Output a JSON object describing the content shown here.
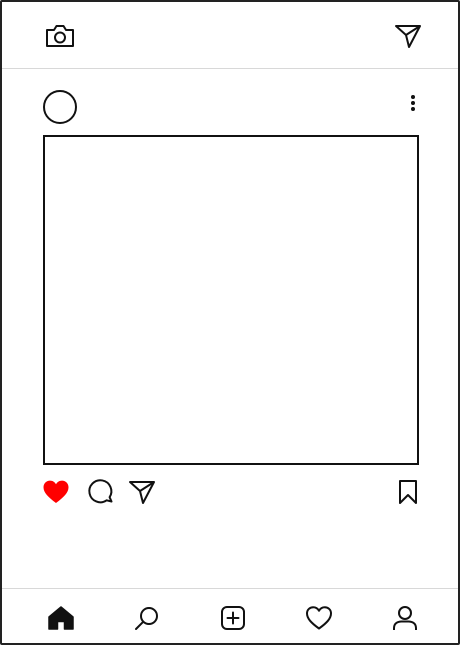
{
  "top_bar": {
    "left_icon": "camera-icon",
    "right_icon": "send-direct-icon"
  },
  "post": {
    "menu_icon": "more-vertical-icon",
    "liked": true,
    "actions": [
      "heart-filled-icon",
      "comment-icon",
      "share-send-icon",
      "bookmark-icon"
    ]
  },
  "bottom_nav": {
    "items": [
      "home-icon",
      "search-icon",
      "add-post-icon",
      "activity-heart-icon",
      "profile-icon"
    ],
    "active": "home-icon"
  },
  "colors": {
    "like_red": "#ff0000",
    "stroke": "#111111",
    "divider": "#d8d8d8",
    "background": "#ffffff"
  }
}
